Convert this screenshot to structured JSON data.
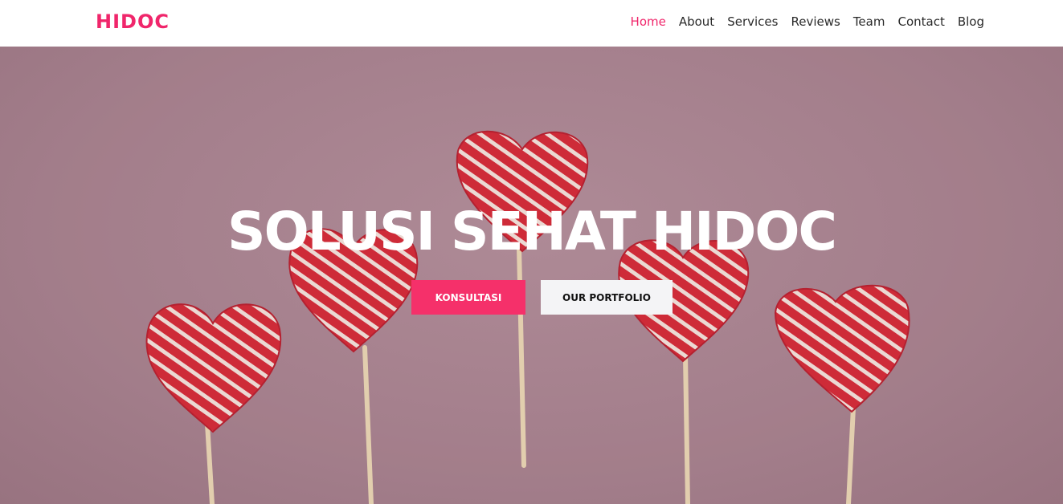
{
  "brand": {
    "name": "HIDOC",
    "color": "#f0266b"
  },
  "nav": {
    "items": [
      {
        "label": "Home",
        "active": true
      },
      {
        "label": "About",
        "active": false
      },
      {
        "label": "Services",
        "active": false
      },
      {
        "label": "Reviews",
        "active": false
      },
      {
        "label": "Team",
        "active": false
      },
      {
        "label": "Contact",
        "active": false
      },
      {
        "label": "Blog",
        "active": false
      }
    ]
  },
  "hero": {
    "title": "SOLUSI SEHAT HIDOC",
    "background_image": "heart-lollipops-on-pink",
    "primary_button": {
      "label": "KONSULTASI",
      "color": "#f5306a"
    },
    "secondary_button": {
      "label": "OUR PORTFOLIO"
    }
  }
}
